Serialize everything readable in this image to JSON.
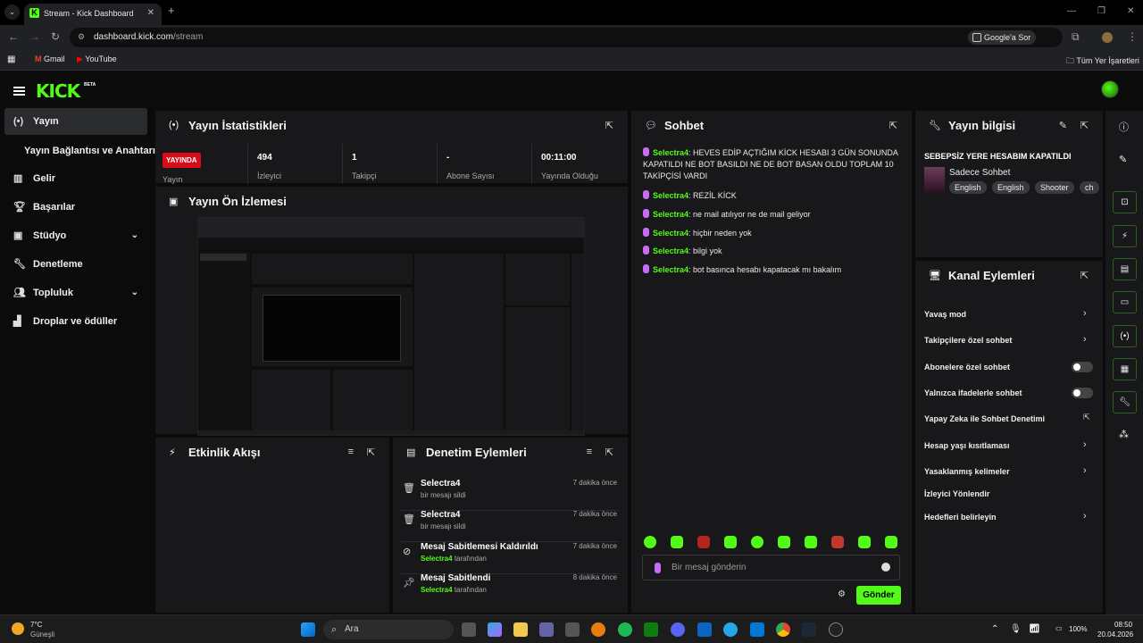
{
  "browser": {
    "tab_title": "Stream - Kick Dashboard",
    "url_host": "dashboard.kick.com",
    "url_path": "/stream",
    "google_ask": "Google'a Sor",
    "bookmarks": [
      "Gmail",
      "YouTube"
    ],
    "all_bookmarks": "Tüm Yer İşaretleri"
  },
  "app": {
    "logo": "KICK",
    "beta": "BETA"
  },
  "sidebar": {
    "items": [
      {
        "label": "Yayın",
        "icon": "broadcast-icon"
      },
      {
        "label": "Yayın Bağlantısı ve Anahtarı",
        "icon": ""
      },
      {
        "label": "Gelir",
        "icon": "chart-icon"
      },
      {
        "label": "Başarılar",
        "icon": "trophy-icon"
      },
      {
        "label": "Stüdyo",
        "icon": "studio-icon"
      },
      {
        "label": "Denetleme",
        "icon": "wrench-icon"
      },
      {
        "label": "Topluluk",
        "icon": "community-icon"
      },
      {
        "label": "Droplar ve ödüller",
        "icon": "drops-icon"
      }
    ]
  },
  "stats": {
    "title": "Yayın İstatistikleri",
    "live_badge": "YAYINDA",
    "stream_label": "Yayın",
    "viewers_value": "494",
    "viewers_label": "İzleyici",
    "followers_value": "1",
    "followers_label": "Takipçi",
    "subs_value": "-",
    "subs_label": "Abone Sayısı",
    "uptime_value": "00:11:00",
    "uptime_label": "Yayında Olduğu"
  },
  "preview": {
    "title": "Yayın Ön İzlemesi"
  },
  "activity": {
    "title": "Etkinlik Akışı"
  },
  "mod_actions": {
    "title": "Denetim Eylemleri",
    "items": [
      {
        "title": "Selectra4",
        "sub": "bir mesajı sildi",
        "user": "",
        "time": "7 dakika önce",
        "icon": "trash-icon"
      },
      {
        "title": "Selectra4",
        "sub": "bir mesajı sildi",
        "user": "",
        "time": "7 dakika önce",
        "icon": "trash-icon"
      },
      {
        "title": "Mesaj Sabitlemesi Kaldırıldı",
        "sub": "tarafından",
        "user": "Selectra4",
        "time": "7 dakika önce",
        "icon": "unpin-icon"
      },
      {
        "title": "Mesaj Sabitlendi",
        "sub": "tarafından",
        "user": "Selectra4",
        "time": "8 dakika önce",
        "icon": "pin-icon"
      }
    ]
  },
  "chat": {
    "title": "Sohbet",
    "messages": [
      {
        "user": "Selectra4",
        "text": ": HEVES EDİP AÇTIĞIM KİCK HESABI 3 GÜN SONUNDA KAPATILDI NE BOT BASILDI NE DE BOT BASAN OLDU TOPLAM 10 TAKİPÇİSİ VARDI"
      },
      {
        "user": "Selectra4",
        "text": ": REZİL KİCK"
      },
      {
        "user": "Selectra4",
        "text": ": ne mail atılıyor ne de mail geliyor"
      },
      {
        "user": "Selectra4",
        "text": ": hiçbir neden yok"
      },
      {
        "user": "Selectra4",
        "text": ": bilgi yok"
      },
      {
        "user": "Selectra4",
        "text": ": bot basınca hesabı kapatacak mı bakalım"
      }
    ],
    "input_placeholder": "Bir mesaj gönderin",
    "send_label": "Gönder"
  },
  "stream_info": {
    "title": "Yayın bilgisi",
    "stream_title": "SEBEPSİZ YERE HESABIM KAPATILDI",
    "category": "Sadece Sohbet",
    "tags": [
      "English",
      "English",
      "Shooter",
      "ch"
    ]
  },
  "channel_actions": {
    "title": "Kanal Eylemleri",
    "items": [
      {
        "label": "Yavaş mod",
        "control": "chevron"
      },
      {
        "label": "Takipçilere özel sohbet",
        "control": "chevron"
      },
      {
        "label": "Abonelere özel sohbet",
        "control": "toggle"
      },
      {
        "label": "Yalnızca ifadelerle sohbet",
        "control": "toggle"
      },
      {
        "label": "Yapay Zeka ile Sohbet Denetimi",
        "control": "external"
      },
      {
        "label": "Hesap yaşı kısıtlaması",
        "control": "chevron"
      },
      {
        "label": "Yasaklanmış kelimeler",
        "control": "chevron"
      },
      {
        "label": "İzleyici Yönlendir",
        "control": "none"
      },
      {
        "label": "Hedefleri belirleyin",
        "control": "chevron"
      }
    ]
  },
  "taskbar": {
    "weather_temp": "7°C",
    "weather_desc": "Güneşli",
    "search_label": "Ara",
    "battery": "100%",
    "time": "08:50",
    "date": "20.04.2026"
  }
}
